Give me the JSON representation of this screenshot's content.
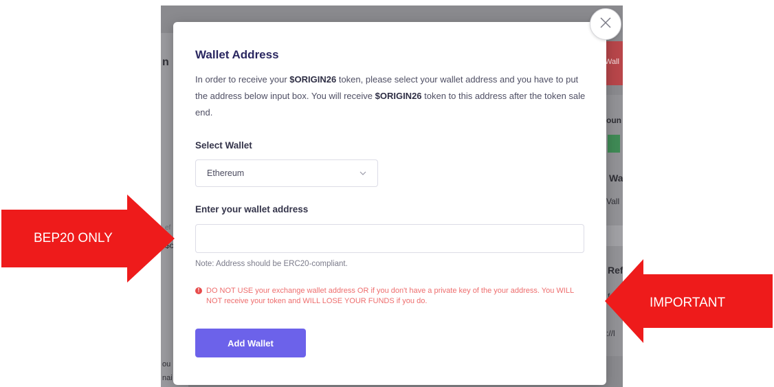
{
  "modal": {
    "title": "Wallet Address",
    "desc_part1": "In order to receive your ",
    "token_name": "$ORIGIN26",
    "desc_part2": " token, please select your wallet address and you have to put the address below input box. You will receive ",
    "token_name_2": "$ORIGIN26",
    "desc_part3": " token to this address after the token sale end.",
    "select_label": "Select Wallet",
    "select_value": "Ethereum",
    "address_label": "Enter your wallet address",
    "address_value": "",
    "note": "Note: Address should be ERC20-compliant.",
    "warning": "DO NOT USE your exchange wallet address OR if you don't have a private key of the your address. You WILL NOT receive your token and WILL LOSE YOUR FUNDS if you do.",
    "add_button": "Add Wallet"
  },
  "annotations": {
    "left_label": "BEP20 ONLY",
    "right_label": "IMPORTANT"
  },
  "background_fragments": {
    "left_heading": "n",
    "right_button": "Wall",
    "right_1": "oun",
    "right_2": "Wa",
    "right_3": "Vall",
    "right_4": "Ref",
    "right_5": "f",
    "right_6": "://l",
    "left_1": "ef",
    "left_2": "$c",
    "left_3": "ou",
    "left_4": "nai"
  },
  "colors": {
    "arrow": "#ee1b1b",
    "accent": "#6c62ea",
    "warning": "#ee6d6d",
    "title": "#2a2760"
  },
  "icons": {
    "close": "close-icon",
    "chevron": "chevron-down-icon",
    "warning": "warning-circle-icon"
  }
}
